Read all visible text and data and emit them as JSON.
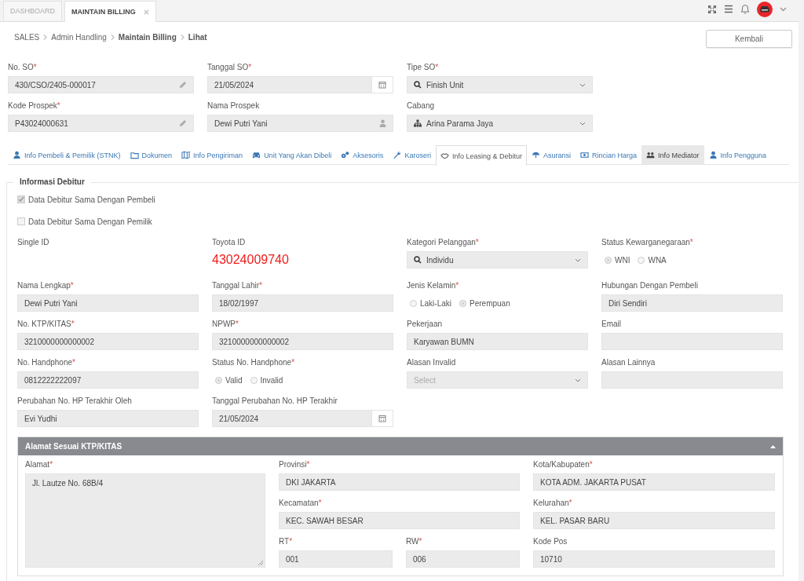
{
  "top_tabs": [
    {
      "label": "DASHBOARD",
      "selected": false,
      "closable": false
    },
    {
      "label": "MAINTAIN BILLING",
      "selected": true,
      "closable": true
    }
  ],
  "breadcrumb": [
    {
      "label": "SALES",
      "bold": false
    },
    {
      "label": "Admin Handling",
      "bold": false
    },
    {
      "label": "Maintain Billing",
      "bold": true
    },
    {
      "label": "Lihat",
      "bold": true
    }
  ],
  "back_button": "Kembali",
  "header_fields": [
    {
      "kind": "pencil",
      "label": "No. SO",
      "mark": "*",
      "value": "430/CSO/2405-000017"
    },
    {
      "kind": "date",
      "label": "Tanggal SO",
      "mark": "*",
      "value": "21/05/2024"
    },
    {
      "kind": "search",
      "label": "Tipe SO",
      "mark": "*",
      "value": "Finish Unit"
    },
    {
      "kind": "pencil",
      "label": "Kode Prospek",
      "mark": "*",
      "value": "P43024000631"
    },
    {
      "kind": "person",
      "label": "Nama Prospek",
      "value": "Dewi Putri Yani"
    },
    {
      "kind": "branch",
      "label": "Cabang",
      "value": "Arina Parama Jaya"
    }
  ],
  "section_tabs": [
    {
      "label": "Info Pembeli & Pemilik (STNK)",
      "selected": false,
      "hovered": false
    },
    {
      "label": "Dokumen",
      "selected": false,
      "hovered": false
    },
    {
      "label": "Info Pengiriman",
      "selected": false,
      "hovered": false
    },
    {
      "label": "Unit Yang Akan Dibeli",
      "selected": false,
      "hovered": false
    },
    {
      "label": "Aksesoris",
      "selected": false,
      "hovered": false
    },
    {
      "label": "Karoseri",
      "selected": false,
      "hovered": false
    },
    {
      "label": "Info Leasing & Debitur",
      "selected": true,
      "hovered": false
    },
    {
      "label": "Asuransi",
      "selected": false,
      "hovered": false
    },
    {
      "label": "Rincian Harga",
      "selected": false,
      "hovered": false
    },
    {
      "label": "Info Mediator",
      "selected": false,
      "hovered": true
    },
    {
      "label": "Info Pengguna",
      "selected": false,
      "hovered": false
    }
  ],
  "debitur": {
    "title": "Informasi Debitur",
    "checkboxes": [
      {
        "label": "Data Debitur Sama Dengan Pembeli",
        "checked": true
      },
      {
        "label": "Data Debitur Sama Dengan Pemilik",
        "checked": false
      }
    ],
    "fields": [
      {
        "kind": "label",
        "label": "Single ID"
      },
      {
        "kind": "id",
        "label": "Toyota ID",
        "value": "43024009740"
      },
      {
        "kind": "search",
        "label": "Kategori Pelanggan",
        "mark": "*",
        "value": "Individu"
      },
      {
        "kind": "radio",
        "label": "Status Kewarganegaraan",
        "mark": "*",
        "options": [
          {
            "label": "WNI",
            "selected": true
          },
          {
            "label": "WNA",
            "selected": false
          }
        ]
      },
      {
        "kind": "text",
        "label": "Nama Lengkap",
        "mark": "*",
        "value": "Dewi Putri Yani"
      },
      {
        "kind": "text",
        "label": "Tanggal Lahir",
        "mark": "*",
        "value": "18/02/1997"
      },
      {
        "kind": "radio",
        "label": "Jenis Kelamin",
        "mark": "*",
        "options": [
          {
            "label": "Laki-Laki",
            "selected": false
          },
          {
            "label": "Perempuan",
            "selected": true
          }
        ]
      },
      {
        "kind": "text",
        "label": "Hubungan Dengan Pembeli",
        "value": "Diri Sendiri"
      },
      {
        "kind": "text",
        "label": "No. KTP/KITAS",
        "mark": "*",
        "value": "3210000000000002"
      },
      {
        "kind": "text",
        "label": "NPWP",
        "mark": "*",
        "value": "3210000000000002"
      },
      {
        "kind": "text",
        "label": "Pekerjaan",
        "value": "Karyawan BUMN"
      },
      {
        "kind": "text",
        "label": "Email"
      },
      {
        "kind": "text",
        "label": "No. Handphone",
        "mark": "*",
        "value": "0812222222097"
      },
      {
        "kind": "radio",
        "label": "Status No. Handphone",
        "mark": "*",
        "options": [
          {
            "label": "Valid",
            "selected": true
          },
          {
            "label": "Invalid",
            "selected": false
          }
        ]
      },
      {
        "kind": "select",
        "label": "Alasan Invalid",
        "placeholder": "Select"
      },
      {
        "kind": "text",
        "label": "Alasan Lainnya"
      },
      {
        "kind": "text",
        "label": "Perubahan No. HP Terakhir Oleh",
        "value": "Evi Yudhi"
      },
      {
        "kind": "date",
        "label": "Tanggal Perubahan No. HP Terakhir",
        "value": "21/05/2024"
      }
    ]
  },
  "address": {
    "title": "Alamat Sesuai KTP/KITAS",
    "expanded": true,
    "textarea": {
      "label": "Alamat",
      "mark": "*",
      "value": "Jl. Lautze No. 68B/4"
    },
    "rows": [
      [
        {
          "label": "Provinsi",
          "mark": "*",
          "value": "DKI JAKARTA"
        },
        {
          "label": "Kota/Kabupaten",
          "mark": "*",
          "value": "KOTA ADM. JAKARTA PUSAT"
        }
      ],
      [
        {
          "label": "Kecamatan",
          "mark": "*",
          "value": "KEC. SAWAH BESAR"
        },
        {
          "label": "Kelurahan",
          "mark": "*",
          "value": "KEL. PASAR BARU"
        }
      ],
      [
        {
          "label": "RT",
          "mark": "*",
          "value": "001"
        },
        {
          "label": "RW",
          "mark": "*",
          "value": "006"
        },
        {
          "label": "Kode Pos",
          "value": "10710"
        }
      ]
    ]
  }
}
